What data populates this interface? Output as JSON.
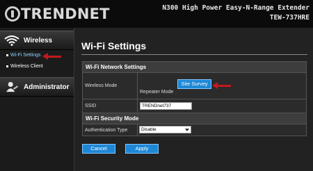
{
  "header": {
    "brand": "TRENDnet",
    "product_name": "N300 High Power Easy-N-Range Extender",
    "model": "TEW-737HRE"
  },
  "sidebar": {
    "wireless_label": "Wireless",
    "items": [
      {
        "label": "Wi-Fi Settings",
        "active": true
      },
      {
        "label": "Wireless Client",
        "active": false
      }
    ],
    "admin_label": "Administrator"
  },
  "main": {
    "title": "Wi-Fi Settings",
    "network_section": "Wi-Fi Network Settings",
    "wireless_mode_label": "Wireless Mode",
    "site_survey_label": "Site Survey",
    "mode_value": "Repeater Mode",
    "ssid_label": "SSID",
    "ssid_value": "TRENDnet737",
    "security_section": "Wi-Fi Security Mode",
    "auth_label": "Authentication Type",
    "auth_value": "Disable",
    "cancel_label": "Cancel",
    "apply_label": "Apply"
  },
  "colors": {
    "accent_blue": "#1e88d6",
    "active_link": "#8fd0ff",
    "annotation_red": "#c2191d"
  }
}
